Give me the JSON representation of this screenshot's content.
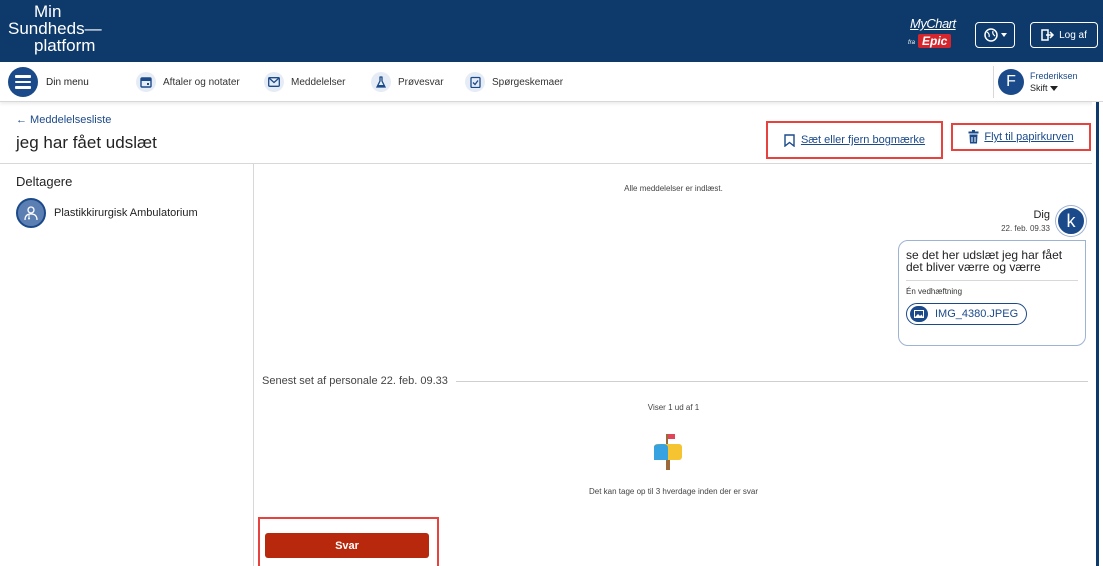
{
  "brand": {
    "line1": "Min",
    "line2": "Sundheds—",
    "line3": "platform"
  },
  "mychart": {
    "name": "MyChart",
    "fra": "fra",
    "epic": "Epic"
  },
  "header": {
    "logout_label": "Log af"
  },
  "nav": {
    "menu_label": "Din menu",
    "items": [
      {
        "label": "Aftaler og notater",
        "icon": "calendar-icon"
      },
      {
        "label": "Meddelelser",
        "icon": "envelope-icon"
      },
      {
        "label": "Prøvesvar",
        "icon": "flask-icon"
      },
      {
        "label": "Spørgeskemaer",
        "icon": "clipboard-check-icon"
      }
    ],
    "user": {
      "initial": "F",
      "name": "Frederiksen",
      "switch_label": "Skift"
    }
  },
  "message": {
    "back_label": "← Meddelelsesliste",
    "subject": "jeg har fået udslæt",
    "bookmark_label": "Sæt eller fjern bogmærke",
    "trash_label": "Flyt til papirkurven",
    "participants_title": "Deltagere",
    "participants": [
      {
        "name": "Plastikkirurgisk Ambulatorium"
      }
    ],
    "all_loaded": "Alle meddelelser er indlæst.",
    "sender": {
      "name": "Dig",
      "initial": "k",
      "time": "22. feb. 09.33"
    },
    "body": "se det her udslæt jeg har fået det bliver værre og værre",
    "attachment_label": "Én vedhæftning",
    "attachment_name": "IMG_4380.JPEG",
    "seen_text": "Senest set af personale 22. feb. 09.33",
    "showing": "Viser 1 ud af 1",
    "reply_note": "Det kan tage op til 3 hverdage inden der er svar",
    "reply_label": "Svar"
  },
  "colors": {
    "navy": "#0e3a6b",
    "link": "#1b4a8a",
    "reply": "#b7280c",
    "highlight": "#e8423f"
  }
}
